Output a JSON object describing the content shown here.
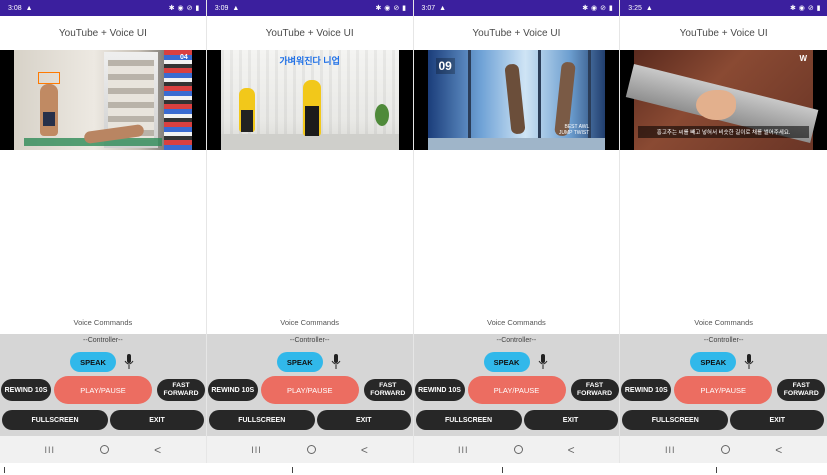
{
  "app_title": "YouTube + Voice UI",
  "voice_commands_label": "Voice Commands",
  "controller_label": "--Controller--",
  "buttons": {
    "speak": "SPEAK",
    "rewind": "REWIND 10S",
    "play_pause": "PLAY/PAUSE",
    "fast_forward": "FAST FORWARD",
    "fullscreen": "FULLSCREEN",
    "exit": "EXIT"
  },
  "navbar": {
    "recent": "III",
    "back": "<"
  },
  "phones": [
    {
      "time": "3:08",
      "video_badge": "04"
    },
    {
      "time": "3:09",
      "video_caption": "가벼워진다 니업"
    },
    {
      "time": "3:07",
      "video_badge": "09",
      "video_tag": "BEST AWL\nJUMP TWIST"
    },
    {
      "time": "3:25",
      "video_watermark": "W",
      "video_subtitle": "흥고추는 씨를 빼고 넣혀서 비슷한 길이로 채를 썰어주세요."
    }
  ],
  "colors": {
    "status_bar": "#3b1f9e",
    "speak_button": "#31b8ea",
    "play_pause_button": "#ec6d61",
    "dark_button": "#272727",
    "controller_bg": "#d6d6d6"
  },
  "icons": {
    "mic": "microphone-icon",
    "status": "status-icons"
  }
}
